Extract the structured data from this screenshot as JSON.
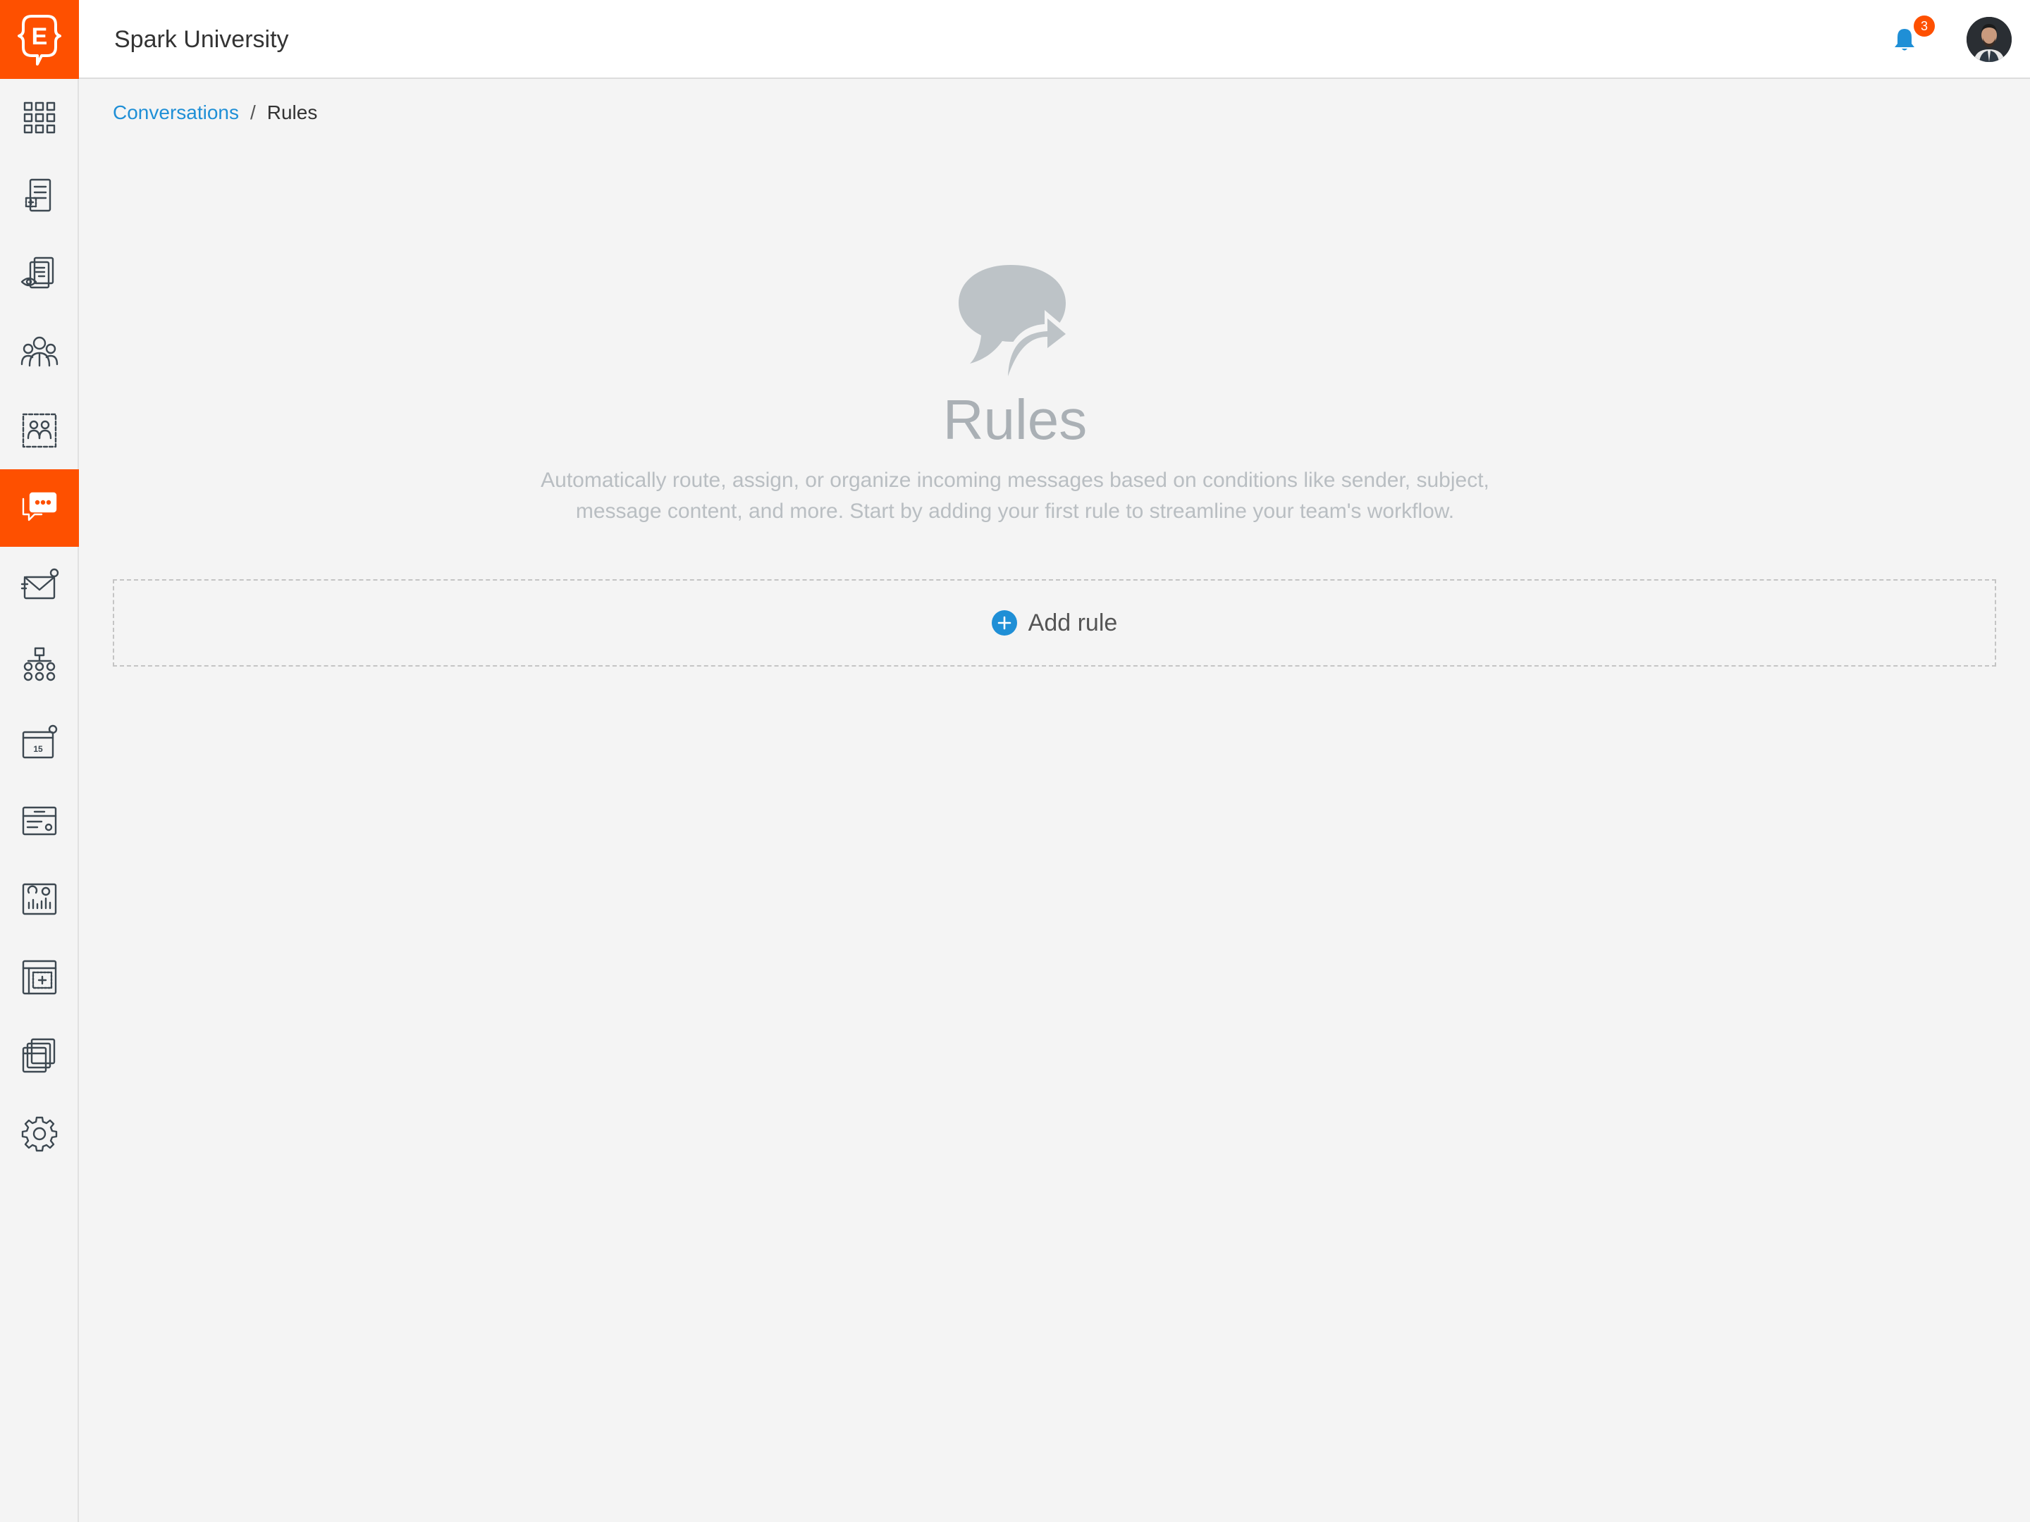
{
  "app": {
    "org_name": "Spark University",
    "brand_color": "#fe5000",
    "logo_letter": "E"
  },
  "header": {
    "notification_count": "3"
  },
  "sidebar": {
    "active_index": 5,
    "items": [
      {
        "icon": "dashboard-grid-icon"
      },
      {
        "icon": "forms-icon"
      },
      {
        "icon": "reviews-icon"
      },
      {
        "icon": "people-icon"
      },
      {
        "icon": "groups-icon"
      },
      {
        "icon": "conversations-icon"
      },
      {
        "icon": "email-icon"
      },
      {
        "icon": "org-chart-icon"
      },
      {
        "icon": "calendar-icon"
      },
      {
        "icon": "records-icon"
      },
      {
        "icon": "reports-icon"
      },
      {
        "icon": "portal-icon"
      },
      {
        "icon": "documents-icon"
      },
      {
        "icon": "settings-gear-icon"
      }
    ]
  },
  "breadcrumb": {
    "parent": "Conversations",
    "separator": "/",
    "current": "Rules"
  },
  "empty_state": {
    "icon": "chat-forward-icon",
    "title": "Rules",
    "description": "Automatically route, assign, or organize incoming messages based on conditions like sender, subject, message content, and more. Start by adding your first rule to streamline your team's workflow."
  },
  "actions": {
    "add_rule_label": "Add rule"
  }
}
